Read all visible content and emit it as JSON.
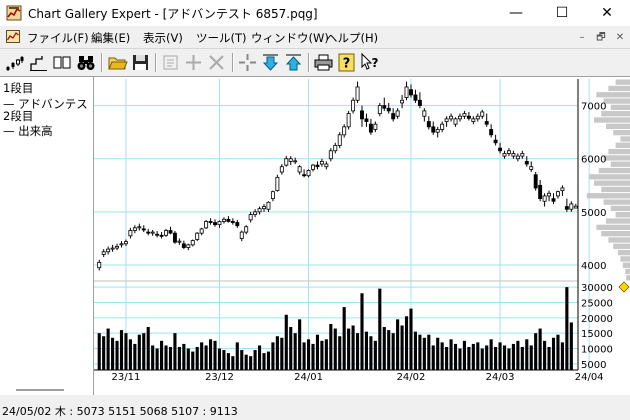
{
  "window": {
    "title": "Chart Gallery Expert - [アドバンテスト 6857.pqg]",
    "minimize": "—",
    "maximize": "☐",
    "close": "✕"
  },
  "menu": {
    "items": [
      {
        "name": "menu-file",
        "label": "ファイル(F)"
      },
      {
        "name": "menu-edit",
        "label": "編集(E)"
      },
      {
        "name": "menu-view",
        "label": "表示(V)"
      },
      {
        "name": "menu-tools",
        "label": "ツール(T)"
      },
      {
        "name": "menu-window",
        "label": "ウィンドウ(W)"
      },
      {
        "name": "menu-help",
        "label": "ヘルプ(H)"
      }
    ],
    "mdi_minimize": "–",
    "mdi_restore": "🗗",
    "mdi_close": "✕"
  },
  "toolbar": {
    "icons": [
      "candle-chart-icon",
      "line-chart-icon",
      "dual-chart-icon",
      "binoculars-icon",
      "open-folder-icon",
      "save-icon",
      "properties-icon",
      "add-icon",
      "delete-icon",
      "crosshair-icon",
      "move-down-icon",
      "move-up-icon",
      "print-icon",
      "help-icon",
      "context-help-icon"
    ]
  },
  "left_pane": {
    "tier1_label": "1段目",
    "tier1_series": "— アドバンテスト",
    "tier2_label": "2段目",
    "tier2_series": "— 出来高"
  },
  "chart_data": {
    "type": "candlestick",
    "price": {
      "ylim": [
        3700,
        7500
      ],
      "yticks": [
        4000,
        5000,
        6000,
        7000
      ],
      "ytick_labels": [
        "4000",
        "5000",
        "6000",
        "7000"
      ],
      "ohlc": [
        [
          3950,
          4100,
          3900,
          4050
        ],
        [
          4200,
          4300,
          4150,
          4250
        ],
        [
          4250,
          4350,
          4200,
          4300
        ],
        [
          4300,
          4380,
          4250,
          4320
        ],
        [
          4320,
          4400,
          4280,
          4350
        ],
        [
          4380,
          4450,
          4330,
          4400
        ],
        [
          4400,
          4480,
          4360,
          4440
        ],
        [
          4550,
          4700,
          4500,
          4650
        ],
        [
          4650,
          4750,
          4600,
          4700
        ],
        [
          4700,
          4780,
          4650,
          4720
        ],
        [
          4680,
          4750,
          4620,
          4660
        ],
        [
          4620,
          4680,
          4560,
          4600
        ],
        [
          4600,
          4660,
          4550,
          4620
        ],
        [
          4580,
          4640,
          4520,
          4560
        ],
        [
          4560,
          4620,
          4500,
          4540
        ],
        [
          4560,
          4680,
          4530,
          4650
        ],
        [
          4650,
          4720,
          4580,
          4600
        ],
        [
          4600,
          4640,
          4400,
          4430
        ],
        [
          4430,
          4500,
          4380,
          4450
        ],
        [
          4400,
          4460,
          4300,
          4330
        ],
        [
          4330,
          4400,
          4280,
          4380
        ],
        [
          4380,
          4480,
          4350,
          4460
        ],
        [
          4480,
          4620,
          4450,
          4600
        ],
        [
          4600,
          4700,
          4560,
          4680
        ],
        [
          4700,
          4850,
          4680,
          4820
        ],
        [
          4820,
          4880,
          4760,
          4800
        ],
        [
          4800,
          4860,
          4720,
          4760
        ],
        [
          4760,
          4840,
          4700,
          4820
        ],
        [
          4820,
          4900,
          4780,
          4860
        ],
        [
          4860,
          4920,
          4800,
          4820
        ],
        [
          4820,
          4880,
          4760,
          4800
        ],
        [
          4800,
          4850,
          4700,
          4740
        ],
        [
          4500,
          4650,
          4450,
          4620
        ],
        [
          4620,
          4750,
          4580,
          4720
        ],
        [
          4850,
          5000,
          4800,
          4950
        ],
        [
          4950,
          5050,
          4900,
          5000
        ],
        [
          5000,
          5100,
          4950,
          5060
        ],
        [
          5060,
          5150,
          5000,
          5100
        ],
        [
          5050,
          5200,
          5000,
          5180
        ],
        [
          5250,
          5400,
          5200,
          5380
        ],
        [
          5400,
          5700,
          5380,
          5650
        ],
        [
          5750,
          5900,
          5700,
          5850
        ],
        [
          5880,
          6050,
          5850,
          6000
        ],
        [
          5950,
          6050,
          5880,
          6000
        ],
        [
          5950,
          6020,
          5900,
          5960
        ],
        [
          5750,
          5880,
          5700,
          5850
        ],
        [
          5700,
          5800,
          5650,
          5680
        ],
        [
          5680,
          5800,
          5650,
          5780
        ],
        [
          5800,
          5900,
          5760,
          5880
        ],
        [
          5880,
          5950,
          5800,
          5850
        ],
        [
          5900,
          6000,
          5850,
          5950
        ],
        [
          5850,
          5950,
          5800,
          5900
        ],
        [
          6000,
          6200,
          5950,
          6150
        ],
        [
          6150,
          6300,
          6100,
          6250
        ],
        [
          6250,
          6500,
          6200,
          6450
        ],
        [
          6450,
          6650,
          6400,
          6600
        ],
        [
          6600,
          6900,
          6550,
          6850
        ],
        [
          6900,
          7150,
          6850,
          7100
        ],
        [
          7100,
          7450,
          7050,
          7350
        ],
        [
          6900,
          7000,
          6600,
          6750
        ],
        [
          6750,
          6850,
          6600,
          6700
        ],
        [
          6650,
          6750,
          6450,
          6500
        ],
        [
          6550,
          6700,
          6500,
          6650
        ],
        [
          6850,
          7050,
          6800,
          7000
        ],
        [
          7000,
          7150,
          6900,
          6950
        ],
        [
          6950,
          7050,
          6850,
          6900
        ],
        [
          6850,
          6950,
          6700,
          6750
        ],
        [
          6800,
          6950,
          6750,
          6900
        ],
        [
          7050,
          7200,
          6950,
          7100
        ],
        [
          7150,
          7450,
          7100,
          7350
        ],
        [
          7300,
          7400,
          7150,
          7200
        ],
        [
          7200,
          7300,
          7050,
          7100
        ],
        [
          7100,
          7250,
          6950,
          7000
        ],
        [
          6800,
          6950,
          6700,
          6900
        ],
        [
          6700,
          6800,
          6550,
          6600
        ],
        [
          6600,
          6700,
          6450,
          6500
        ],
        [
          6500,
          6600,
          6400,
          6550
        ],
        [
          6550,
          6700,
          6500,
          6650
        ],
        [
          6700,
          6800,
          6600,
          6750
        ],
        [
          6750,
          6850,
          6700,
          6800
        ],
        [
          6650,
          6780,
          6600,
          6750
        ],
        [
          6750,
          6850,
          6700,
          6800
        ],
        [
          6800,
          6900,
          6750,
          6850
        ],
        [
          6800,
          6880,
          6720,
          6760
        ],
        [
          6700,
          6800,
          6650,
          6750
        ],
        [
          6750,
          6850,
          6700,
          6800
        ],
        [
          6800,
          6920,
          6750,
          6880
        ],
        [
          6700,
          6850,
          6600,
          6650
        ],
        [
          6550,
          6650,
          6400,
          6450
        ],
        [
          6350,
          6450,
          6250,
          6300
        ],
        [
          6200,
          6300,
          6100,
          6150
        ],
        [
          6050,
          6150,
          6000,
          6100
        ],
        [
          6100,
          6200,
          6050,
          6150
        ],
        [
          6050,
          6150,
          6000,
          6100
        ],
        [
          6000,
          6100,
          5950,
          6050
        ],
        [
          6050,
          6150,
          6000,
          6100
        ],
        [
          5950,
          6050,
          5850,
          5900
        ],
        [
          5800,
          5950,
          5750,
          5850
        ],
        [
          5700,
          5750,
          5400,
          5450
        ],
        [
          5500,
          5600,
          5200,
          5250
        ],
        [
          5200,
          5350,
          5100,
          5300
        ],
        [
          5300,
          5400,
          5200,
          5350
        ],
        [
          5250,
          5350,
          5150,
          5200
        ],
        [
          5300,
          5400,
          5250,
          5380
        ],
        [
          5400,
          5500,
          5300,
          5450
        ],
        [
          5100,
          5250,
          5000,
          5050
        ],
        [
          5050,
          5200,
          5000,
          5150
        ],
        [
          5073,
          5151,
          5068,
          5107
        ]
      ],
      "volume_profile": [
        0.3,
        0.45,
        0.7,
        0.55,
        0.4,
        0.6,
        0.75,
        0.5,
        0.35,
        0.2,
        0.3,
        0.45,
        0.55,
        0.4,
        0.65,
        0.85,
        0.75,
        0.6,
        0.9,
        0.55,
        0.4,
        0.3,
        0.5,
        0.7,
        0.6,
        0.45,
        0.35,
        0.25,
        0.2,
        0.15,
        0.1,
        0.08
      ]
    },
    "volume": {
      "ylim": [
        3000,
        32000
      ],
      "yticks": [
        5000,
        10000,
        15000,
        20000,
        25000,
        30000
      ],
      "ytick_labels": [
        "5000",
        "10000",
        "15000",
        "20000",
        "25000",
        "30000"
      ],
      "values": [
        15000,
        14000,
        16500,
        13500,
        12500,
        16000,
        15000,
        13000,
        11500,
        14500,
        15000,
        17000,
        11000,
        10000,
        12500,
        11000,
        10500,
        15000,
        10500,
        11500,
        10000,
        9000,
        10500,
        12000,
        11000,
        13000,
        12500,
        10000,
        9500,
        8500,
        7500,
        12000,
        9500,
        8000,
        7500,
        9500,
        11000,
        8500,
        9000,
        12000,
        14000,
        13500,
        21000,
        17000,
        15000,
        19500,
        12000,
        13000,
        11500,
        14500,
        12500,
        13000,
        18000,
        16500,
        14000,
        23500,
        16500,
        17500,
        15000,
        28000,
        15500,
        14000,
        12500,
        29500,
        17000,
        16000,
        15000,
        19500,
        17500,
        20500,
        23000,
        15500,
        14500,
        13500,
        14500,
        11000,
        13500,
        12000,
        10500,
        13000,
        11500,
        10000,
        12500,
        10500,
        11500,
        12000,
        10000,
        11000,
        13000,
        10500,
        12000,
        11000,
        10000,
        11500,
        12500,
        10500,
        13000,
        11000,
        15000,
        16500,
        12500,
        10500,
        13500,
        14500,
        12000,
        30000,
        18500
      ]
    },
    "x_tick_labels": [
      "23/11",
      "23/12",
      "24/01",
      "24/02",
      "24/03",
      "24/04"
    ],
    "x_tick_index": [
      6,
      27,
      47,
      70,
      90,
      110
    ],
    "status": "24/05/02 木 : 5073 5151 5068 5107 : 9113"
  },
  "colors": {
    "grid": "#9ee4f0",
    "bar": "#000000",
    "profile": "#c8c8c8",
    "marker": "#ffd700"
  }
}
